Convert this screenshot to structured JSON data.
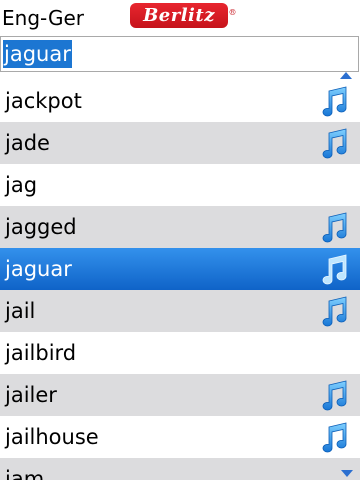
{
  "header": {
    "language_pair": "Eng-Ger",
    "logo_text": "Berlitz",
    "logo_reg": "®"
  },
  "search": {
    "value": "jaguar"
  },
  "list": {
    "items": [
      {
        "word": "jackpot",
        "audio": true
      },
      {
        "word": "jade",
        "audio": true
      },
      {
        "word": "jag",
        "audio": false
      },
      {
        "word": "jagged",
        "audio": true
      },
      {
        "word": "jaguar",
        "audio": true,
        "selected": true
      },
      {
        "word": "jail",
        "audio": true
      },
      {
        "word": "jailbird",
        "audio": false
      },
      {
        "word": "jailer",
        "audio": true
      },
      {
        "word": "jailhouse",
        "audio": true
      },
      {
        "word": "jam",
        "audio": false
      }
    ],
    "audio_icon": "music-note-icon"
  },
  "colors": {
    "selection": "#1c76d2",
    "alt_row": "#dcdcde",
    "brand_red": "#d2161e",
    "icon_blue": "#1e90e6"
  }
}
